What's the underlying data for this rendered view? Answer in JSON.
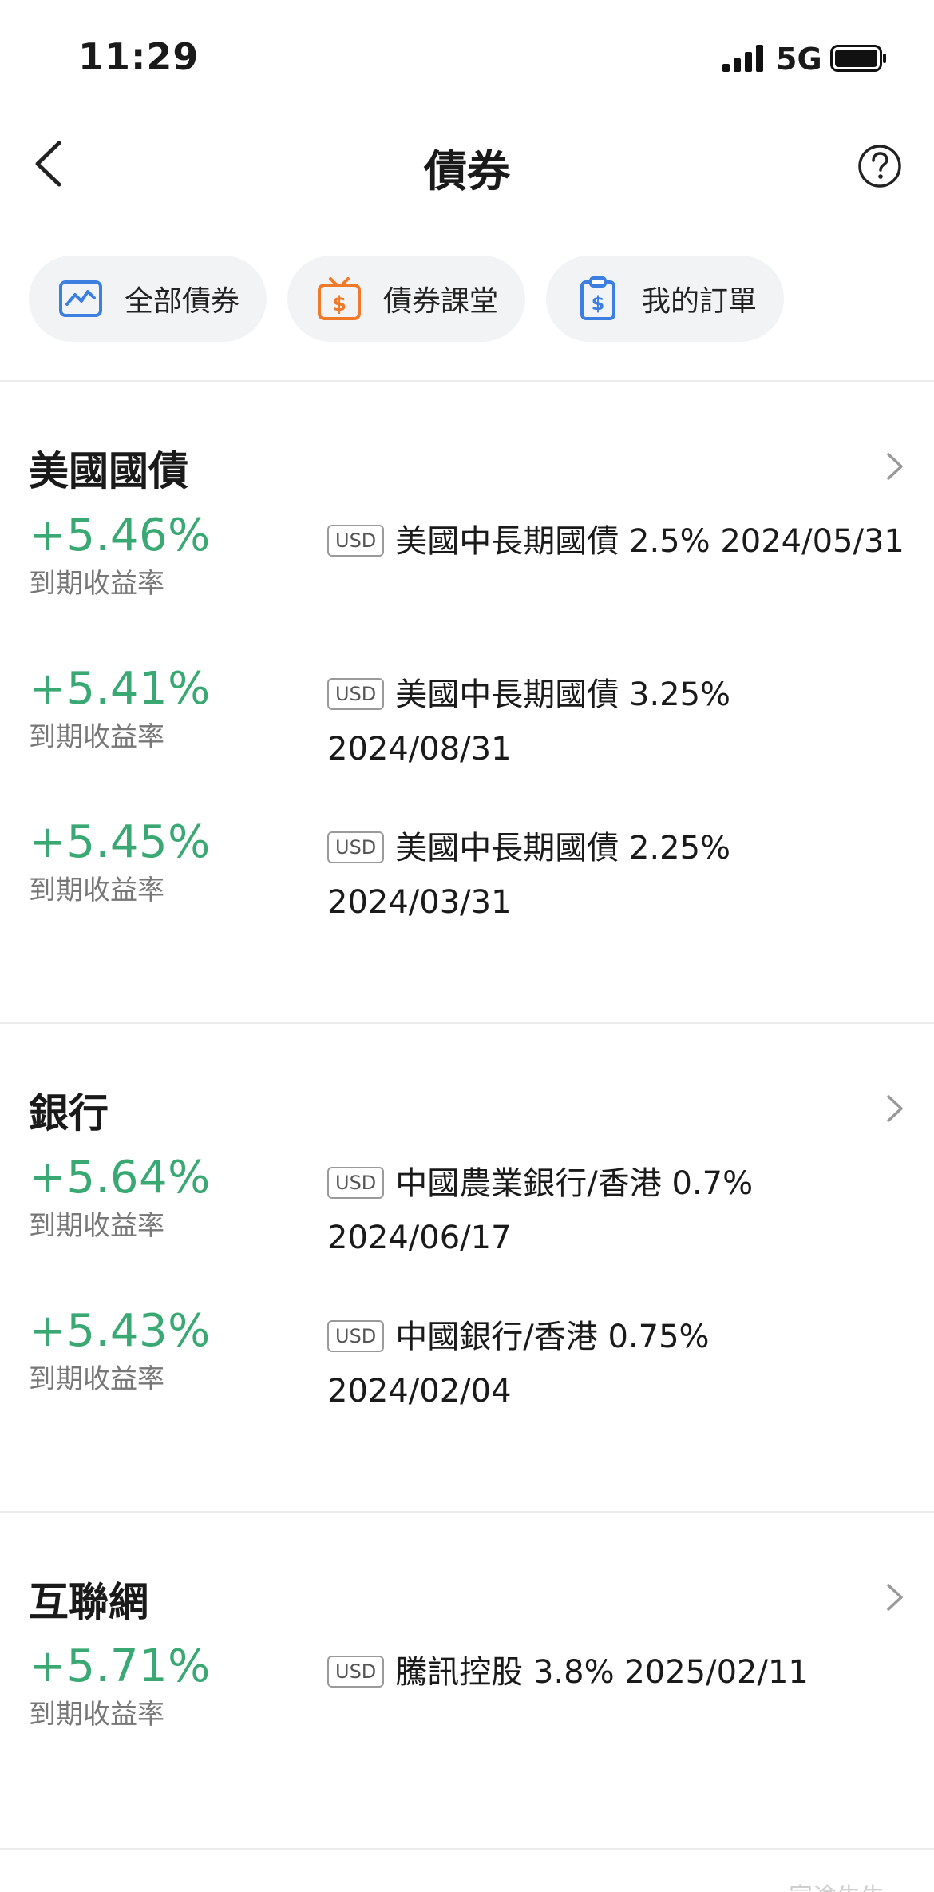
{
  "status_bar": {
    "time": "11:29",
    "network": "5G"
  },
  "nav": {
    "title": "債券"
  },
  "quick_actions": [
    {
      "label": "全部債券",
      "icon": "chart-icon",
      "color": "#3d7fe0"
    },
    {
      "label": "債券課堂",
      "icon": "tv-dollar-icon",
      "color": "#f07a2a"
    },
    {
      "label": "我的訂單",
      "icon": "clipboard-dollar-icon",
      "color": "#3d7fe0"
    }
  ],
  "yield_color": "#3aa873",
  "sections": [
    {
      "title": "美國國債",
      "bonds": [
        {
          "yield": "+5.46%",
          "yield_label": "到期收益率",
          "currency": "USD",
          "name": "美國中長期國債 2.5% 2024/05/31"
        },
        {
          "yield": "+5.41%",
          "yield_label": "到期收益率",
          "currency": "USD",
          "name": "美國中長期國債 3.25% 2024/08/31"
        },
        {
          "yield": "+5.45%",
          "yield_label": "到期收益率",
          "currency": "USD",
          "name": "美國中長期國債 2.25% 2024/03/31"
        }
      ]
    },
    {
      "title": "銀行",
      "bonds": [
        {
          "yield": "+5.64%",
          "yield_label": "到期收益率",
          "currency": "USD",
          "name": "中國農業銀行/香港 0.7% 2024/06/17"
        },
        {
          "yield": "+5.43%",
          "yield_label": "到期收益率",
          "currency": "USD",
          "name": "中國銀行/香港 0.75% 2024/02/04"
        }
      ]
    },
    {
      "title": "互聯網",
      "bonds": [
        {
          "yield": "+5.71%",
          "yield_label": "到期收益率",
          "currency": "USD",
          "name": "騰訊控股 3.8% 2025/02/11"
        }
      ]
    }
  ],
  "watermark": "富途牛牛"
}
